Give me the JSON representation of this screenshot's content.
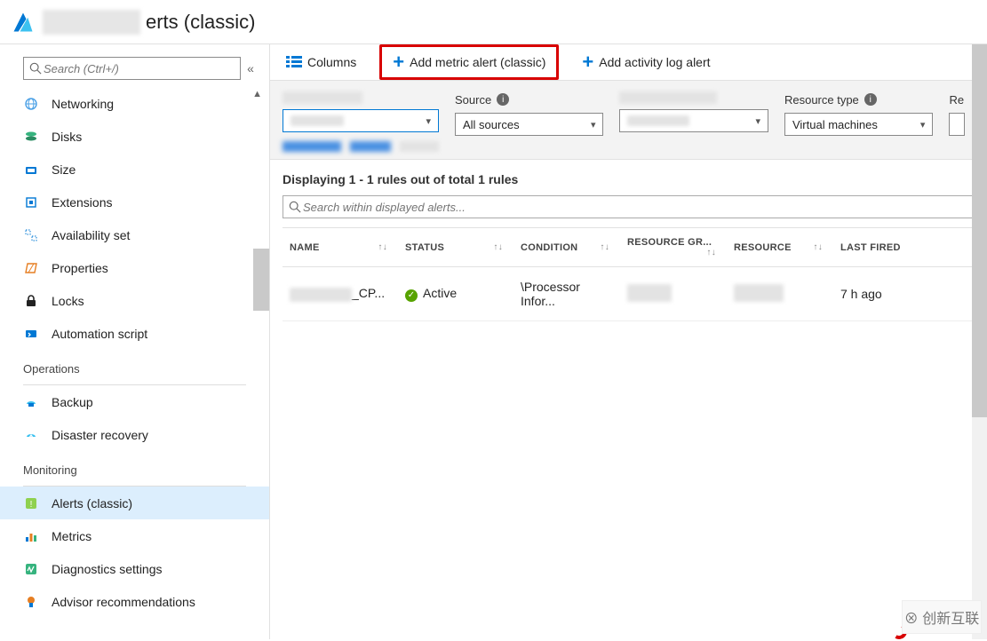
{
  "header": {
    "title_suffix": "erts (classic)"
  },
  "search": {
    "placeholder": "Search (Ctrl+/)"
  },
  "sidebar": {
    "items": [
      {
        "label": "Networking",
        "icon": "network-icon"
      },
      {
        "label": "Disks",
        "icon": "disks-icon"
      },
      {
        "label": "Size",
        "icon": "size-icon"
      },
      {
        "label": "Extensions",
        "icon": "extensions-icon"
      },
      {
        "label": "Availability set",
        "icon": "availability-icon"
      },
      {
        "label": "Properties",
        "icon": "properties-icon"
      },
      {
        "label": "Locks",
        "icon": "lock-icon"
      },
      {
        "label": "Automation script",
        "icon": "automation-icon"
      }
    ],
    "operations_header": "Operations",
    "operations": [
      {
        "label": "Backup",
        "icon": "backup-icon"
      },
      {
        "label": "Disaster recovery",
        "icon": "recovery-icon"
      }
    ],
    "monitoring_header": "Monitoring",
    "monitoring": [
      {
        "label": "Alerts (classic)",
        "icon": "alert-icon",
        "selected": true
      },
      {
        "label": "Metrics",
        "icon": "metrics-icon"
      },
      {
        "label": "Diagnostics settings",
        "icon": "diagnostics-icon"
      },
      {
        "label": "Advisor recommendations",
        "icon": "advisor-icon"
      }
    ]
  },
  "toolbar": {
    "columns": "Columns",
    "add_metric_alert": "Add metric alert (classic)",
    "add_activity_log_alert": "Add activity log alert"
  },
  "filters": {
    "source_label": "Source",
    "source_value": "All sources",
    "resource_type_label": "Resource type",
    "resource_type_value": "Virtual machines",
    "partial_label": "Re"
  },
  "results": {
    "summary": "Displaying 1 - 1 rules out of total 1 rules",
    "search_placeholder": "Search within displayed alerts..."
  },
  "table": {
    "headers": {
      "name": "NAME",
      "status": "STATUS",
      "condition": "CONDITION",
      "resource_group": "RESOURCE GR...",
      "resource": "RESOURCE",
      "last_fired": "LAST FIRED"
    },
    "rows": [
      {
        "name_suffix": "_CP...",
        "status": "Active",
        "condition": "\\Processor Infor...",
        "last_fired": "7 h ago"
      }
    ]
  }
}
